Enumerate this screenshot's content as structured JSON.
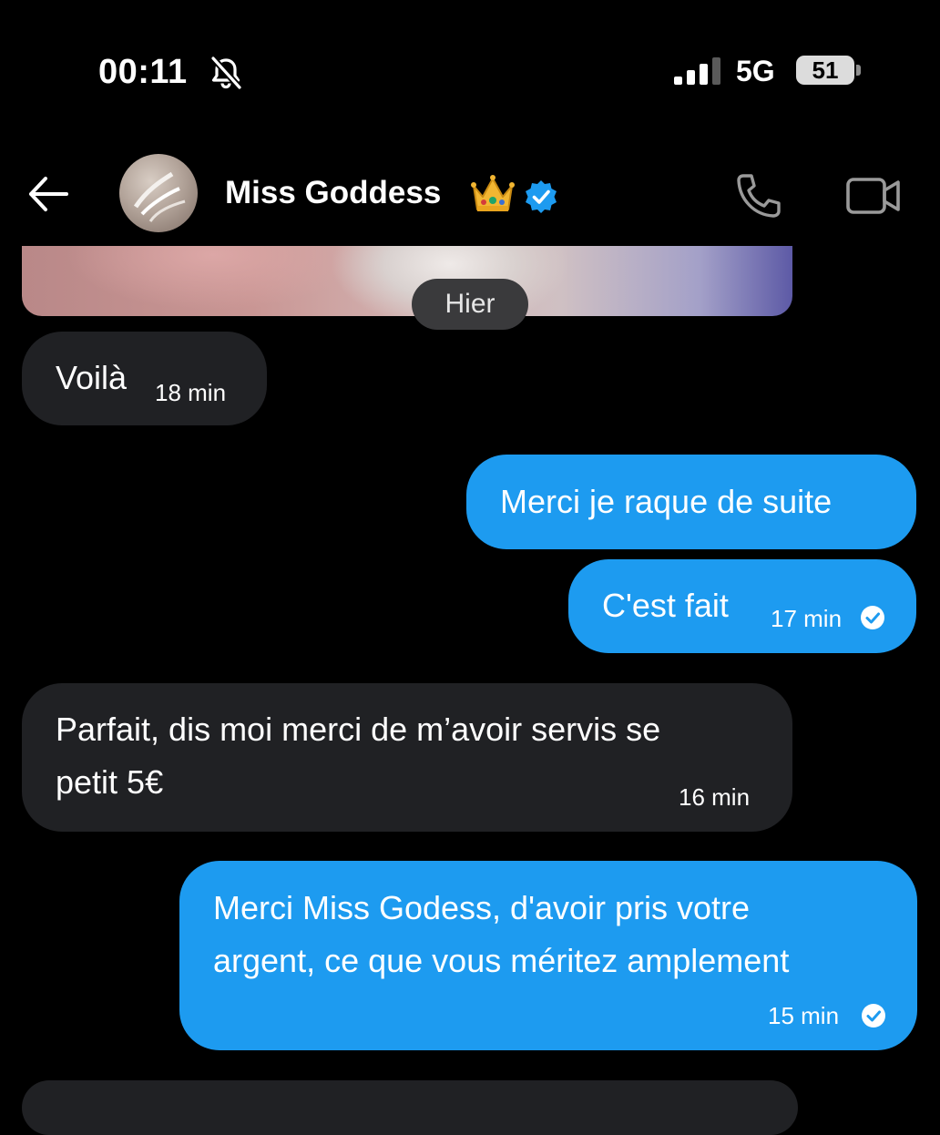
{
  "status_bar": {
    "time": "00:11",
    "network": "5G",
    "battery": "51"
  },
  "header": {
    "contact_name": "Miss Goddess"
  },
  "date_separator": "Hier",
  "messages": [
    {
      "direction": "in",
      "text": "Voilà",
      "time": "18 min"
    },
    {
      "direction": "out",
      "text": "Merci je raque de suite"
    },
    {
      "direction": "out",
      "text": "C'est fait",
      "time": "17 min",
      "read": true
    },
    {
      "direction": "in",
      "lines": [
        "Parfait, dis moi merci de m’avoir servis se",
        "petit 5€"
      ],
      "time": "16 min"
    },
    {
      "direction": "out",
      "lines": [
        "Merci Miss Godess, d'avoir pris votre",
        "argent, ce que vous méritez amplement"
      ],
      "time": "15 min",
      "read": true
    }
  ],
  "colors": {
    "outgoing_bubble": "#1d9bf0",
    "incoming_bubble": "#202124",
    "verified_badge": "#1d9bf0",
    "background": "#000000"
  },
  "icons": [
    "bell-slash-icon",
    "signal-icon",
    "back-arrow-icon",
    "crown-emoji-icon",
    "verified-badge-icon",
    "phone-icon",
    "video-camera-icon",
    "read-check-icon"
  ]
}
